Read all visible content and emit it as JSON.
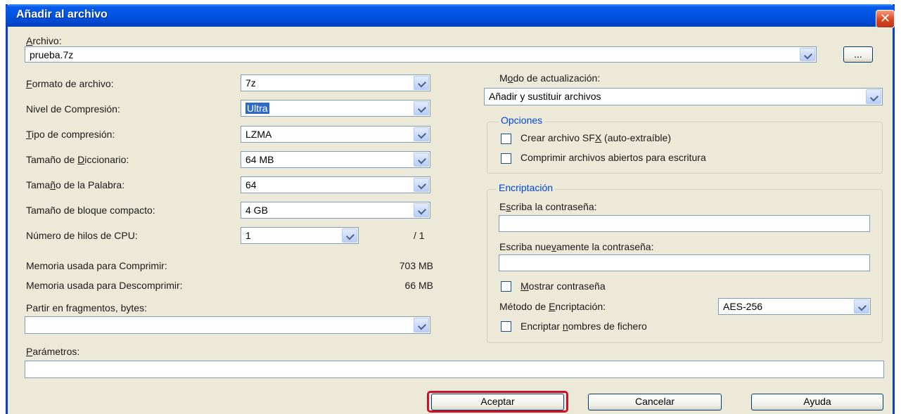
{
  "window": {
    "title": "Añadir al archivo",
    "close_glyph": "✕"
  },
  "archivo": {
    "label_u": "A",
    "label_rest": "rchivo:",
    "value": "prueba.7z",
    "browse_label": "..."
  },
  "left": {
    "formato": {
      "u": "F",
      "rest": "ormato de archivo:",
      "value": "7z"
    },
    "nivel": {
      "label": "Nivel de Compresión:",
      "value": "Ultra"
    },
    "tipo": {
      "u": "T",
      "rest": "ipo de compresión:",
      "value": "LZMA"
    },
    "diccionario": {
      "pre": "Tamaño de ",
      "u": "D",
      "rest": "iccionario:",
      "value": "64 MB"
    },
    "palabra": {
      "pre": "Tama",
      "u": "ñ",
      "rest": "o de la Palabra:",
      "value": "64"
    },
    "bloque": {
      "label": "Tamaño de bloque compacto:",
      "value": "4 GB"
    },
    "hilos": {
      "label": "Número de hilos de CPU:",
      "value": "1",
      "total": "/ 1"
    },
    "mem_comp": {
      "label": "Memoria usada para Comprimir:",
      "value": "703 MB"
    },
    "mem_desc": {
      "label": "Memoria usada para Descomprimir:",
      "value": "66 MB"
    },
    "partir": {
      "label": "Partir en fragmentos, bytes:",
      "value": ""
    }
  },
  "right": {
    "modo": {
      "pre": "M",
      "u": "o",
      "rest": "do de actualización:",
      "value": "Añadir y sustituir archivos"
    },
    "opciones": {
      "title": "Opciones",
      "sfx": {
        "pre": "Crear archivo SF",
        "u": "X",
        "rest": " (auto-extraíble)"
      },
      "abiertos": {
        "label": "Comprimir archivos abiertos para escritura"
      }
    },
    "encriptacion": {
      "title": "Encriptación",
      "pass_pre": "E",
      "pass_u": "s",
      "pass_rest": "criba la contraseña:",
      "pass2_pre": "Escriba nue",
      "pass2_u": "v",
      "pass2_rest": "amente la contraseña:",
      "mostrar_u": "M",
      "mostrar_rest": "ostrar contraseña",
      "metodo_pre": "Método de ",
      "metodo_u": "E",
      "metodo_rest": "ncriptación:",
      "metodo_value": "AES-256",
      "nombres_pre": "Encriptar ",
      "nombres_u": "n",
      "nombres_rest": "ombres de fichero"
    }
  },
  "parametros": {
    "u": "P",
    "rest": "arámetros:",
    "value": ""
  },
  "buttons": {
    "aceptar": "Aceptar",
    "cancelar": "Cancelar",
    "ayuda": "Ayuda"
  },
  "colors": {
    "title_bar": "#0055e5",
    "highlight": "#d0102a",
    "selection": "#316ac5",
    "group_title": "#0046d5"
  }
}
